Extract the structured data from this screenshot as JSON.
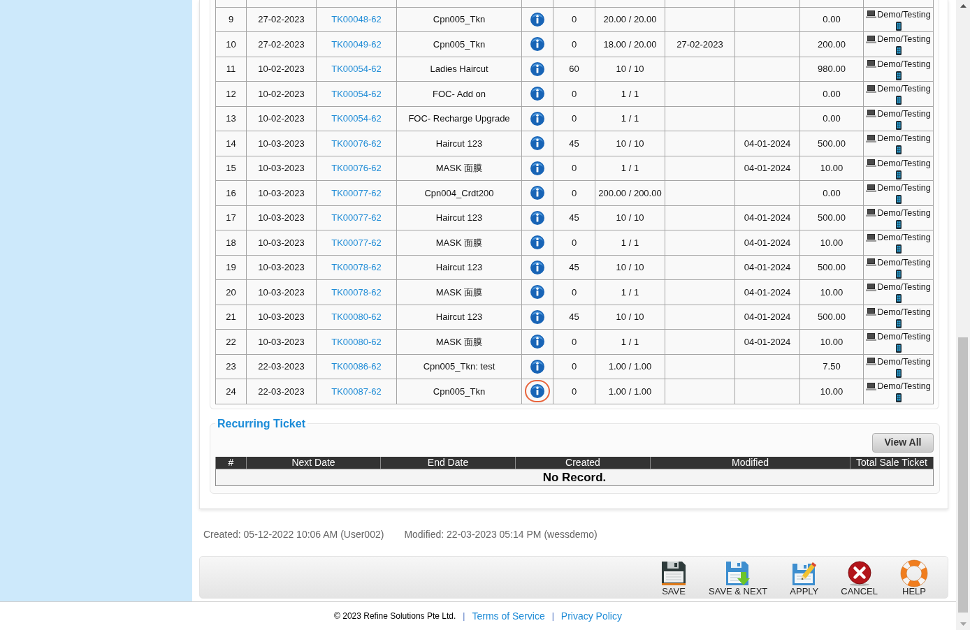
{
  "table": {
    "columns": [
      {
        "kind": "text"
      },
      {
        "kind": "text"
      },
      {
        "kind": "link"
      },
      {
        "kind": "text"
      },
      {
        "kind": "info"
      },
      {
        "kind": "text"
      },
      {
        "kind": "text"
      },
      {
        "kind": "text"
      },
      {
        "kind": "text"
      },
      {
        "kind": "text"
      },
      {
        "kind": "device"
      }
    ],
    "rows": [
      {
        "column_1": "9",
        "column_2": "27-02-2023",
        "column_3": "TK00048-62",
        "column_4": "Cpn005_Tkn",
        "column_6": "0",
        "column_7": "20.00 / 20.00",
        "column_10": "0.00",
        "column_11": "Demo/Testing",
        "info_highlighted": false
      },
      {
        "column_1": "10",
        "column_2": "27-02-2023",
        "column_3": "TK00049-62",
        "column_4": "Cpn005_Tkn",
        "column_6": "0",
        "column_7": "18.00 / 20.00",
        "column_8": "27-02-2023",
        "column_10": "200.00",
        "column_11": "Demo/Testing",
        "info_highlighted": false
      },
      {
        "column_1": "11",
        "column_2": "10-02-2023",
        "column_3": "TK00054-62",
        "column_4": "Ladies Haircut",
        "column_6": "60",
        "column_7": "10 / 10",
        "column_10": "980.00",
        "column_11": "Demo/Testing",
        "info_highlighted": false
      },
      {
        "column_1": "12",
        "column_2": "10-02-2023",
        "column_3": "TK00054-62",
        "column_4": "FOC- Add on",
        "column_6": "0",
        "column_7": "1 / 1",
        "column_10": "0.00",
        "column_11": "Demo/Testing",
        "info_highlighted": false
      },
      {
        "column_1": "13",
        "column_2": "10-02-2023",
        "column_3": "TK00054-62",
        "column_4": "FOC- Recharge Upgrade",
        "column_6": "0",
        "column_7": "1 / 1",
        "column_10": "0.00",
        "column_11": "Demo/Testing",
        "info_highlighted": false
      },
      {
        "column_1": "14",
        "column_2": "10-03-2023",
        "column_3": "TK00076-62",
        "column_4": "Haircut 123",
        "column_6": "45",
        "column_7": "10 / 10",
        "column_9": "04-01-2024",
        "column_10": "500.00",
        "column_11": "Demo/Testing",
        "info_highlighted": false
      },
      {
        "column_1": "15",
        "column_2": "10-03-2023",
        "column_3": "TK00076-62",
        "column_4": "MASK 面膜",
        "column_6": "0",
        "column_7": "1 / 1",
        "column_9": "04-01-2024",
        "column_10": "10.00",
        "column_11": "Demo/Testing",
        "info_highlighted": false
      },
      {
        "column_1": "16",
        "column_2": "10-03-2023",
        "column_3": "TK00077-62",
        "column_4": "Cpn004_Crdt200",
        "column_6": "0",
        "column_7": "200.00 / 200.00",
        "column_10": "0.00",
        "column_11": "Demo/Testing",
        "info_highlighted": false
      },
      {
        "column_1": "17",
        "column_2": "10-03-2023",
        "column_3": "TK00077-62",
        "column_4": "Haircut 123",
        "column_6": "45",
        "column_7": "10 / 10",
        "column_9": "04-01-2024",
        "column_10": "500.00",
        "column_11": "Demo/Testing",
        "info_highlighted": false
      },
      {
        "column_1": "18",
        "column_2": "10-03-2023",
        "column_3": "TK00077-62",
        "column_4": "MASK 面膜",
        "column_6": "0",
        "column_7": "1 / 1",
        "column_9": "04-01-2024",
        "column_10": "10.00",
        "column_11": "Demo/Testing",
        "info_highlighted": false
      },
      {
        "column_1": "19",
        "column_2": "10-03-2023",
        "column_3": "TK00078-62",
        "column_4": "Haircut 123",
        "column_6": "45",
        "column_7": "10 / 10",
        "column_9": "04-01-2024",
        "column_10": "500.00",
        "column_11": "Demo/Testing",
        "info_highlighted": false
      },
      {
        "column_1": "20",
        "column_2": "10-03-2023",
        "column_3": "TK00078-62",
        "column_4": "MASK 面膜",
        "column_6": "0",
        "column_7": "1 / 1",
        "column_9": "04-01-2024",
        "column_10": "10.00",
        "column_11": "Demo/Testing",
        "info_highlighted": false
      },
      {
        "column_1": "21",
        "column_2": "10-03-2023",
        "column_3": "TK00080-62",
        "column_4": "Haircut 123",
        "column_6": "45",
        "column_7": "10 / 10",
        "column_9": "04-01-2024",
        "column_10": "500.00",
        "column_11": "Demo/Testing",
        "info_highlighted": false
      },
      {
        "column_1": "22",
        "column_2": "10-03-2023",
        "column_3": "TK00080-62",
        "column_4": "MASK 面膜",
        "column_6": "0",
        "column_7": "1 / 1",
        "column_9": "04-01-2024",
        "column_10": "10.00",
        "column_11": "Demo/Testing",
        "info_highlighted": false
      },
      {
        "column_1": "23",
        "column_2": "22-03-2023",
        "column_3": "TK00086-62",
        "column_4": "Cpn005_Tkn: test",
        "column_6": "0",
        "column_7": "1.00 / 1.00",
        "column_10": "7.50",
        "column_11": "Demo/Testing",
        "info_highlighted": false
      },
      {
        "column_1": "24",
        "column_2": "22-03-2023",
        "column_3": "TK00087-62",
        "column_4": "Cpn005_Tkn",
        "column_6": "0",
        "column_7": "1.00 / 1.00",
        "column_10": "10.00",
        "column_11": "Demo/Testing",
        "info_highlighted": true
      }
    ]
  },
  "recurring_ticket": {
    "title": "Recurring Ticket",
    "view_all_button": "View All",
    "columns": [
      "#",
      "Next Date",
      "End Date",
      "Created",
      "Modified",
      "Total Sale Ticket"
    ],
    "empty_message": "No Record."
  },
  "audit_trail": [
    "Created: 05-12-2022 10:06 AM (User002)",
    "Modified: 22-03-2023 05:14 PM (wessdemo)"
  ],
  "toolbar": {
    "buttons": [
      {
        "kind": "save",
        "label": "SAVE"
      },
      {
        "kind": "save_next",
        "label": "SAVE & NEXT"
      },
      {
        "kind": "apply",
        "label": "APPLY"
      },
      {
        "kind": "cancel",
        "label": "CANCEL"
      },
      {
        "kind": "help",
        "label": "HELP"
      }
    ]
  },
  "footer": {
    "items": [
      {
        "kind": "text",
        "text": "© 2023 Refine Solutions Pte Ltd."
      },
      {
        "kind": "separator",
        "text": "|"
      },
      {
        "kind": "link",
        "text": "Terms of Service"
      },
      {
        "kind": "separator",
        "text": "|"
      },
      {
        "kind": "link",
        "text": "Privacy Policy"
      }
    ]
  }
}
